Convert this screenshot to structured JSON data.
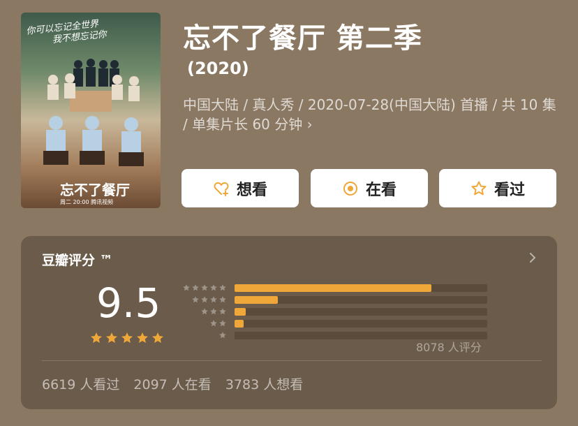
{
  "poster": {
    "tagline": [
      "你可以忘记全世界",
      "我不想忘记你"
    ],
    "logo": "忘不了餐厅",
    "airtime": "周二 20:00 腾讯视频"
  },
  "title": "忘不了餐厅 第二季",
  "year": "(2020)",
  "meta": "中国大陆 / 真人秀 / 2020-07-28(中国大陆) 首播 / 共 10 集 / 单集片长 60 分钟 ›",
  "buttons": {
    "want": "想看",
    "doing": "在看",
    "done": "看过"
  },
  "rating": {
    "title": "豆瓣评分 ™",
    "score": "9.5",
    "stars": 5,
    "distribution": [
      {
        "stars": 5,
        "fraction": 0.78
      },
      {
        "stars": 4,
        "fraction": 0.17
      },
      {
        "stars": 3,
        "fraction": 0.045
      },
      {
        "stars": 2,
        "fraction": 0.035
      },
      {
        "stars": 1,
        "fraction": 0.0
      }
    ],
    "count": "8078 人评分"
  },
  "stats": {
    "done": "6619 人看过",
    "doing": "2097 人在看",
    "want": "3783 人想看"
  },
  "colors": {
    "background": "#8a7862",
    "panel": "#6b5b4a",
    "accent": "#f0a73a"
  }
}
